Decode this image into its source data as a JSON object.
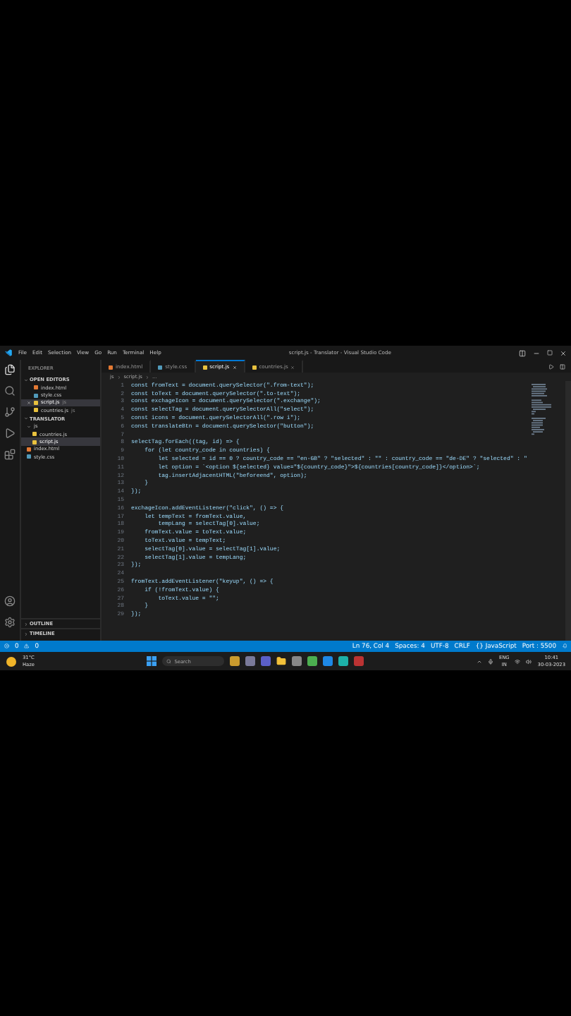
{
  "window": {
    "title": "script.js - Translator - Visual Studio Code"
  },
  "menu": [
    "File",
    "Edit",
    "Selection",
    "View",
    "Go",
    "Run",
    "Terminal",
    "Help"
  ],
  "sidebar": {
    "title": "EXPLORER",
    "sections": [
      {
        "label": "OPEN EDITORS",
        "expanded": true,
        "items": [
          {
            "name": "index.html",
            "kind": "html",
            "selected": false,
            "closable": false
          },
          {
            "name": "style.css",
            "kind": "css",
            "selected": false,
            "closable": false
          },
          {
            "name": "script.js",
            "kind": "js",
            "hint": "js",
            "selected": true,
            "closable": true
          },
          {
            "name": "countries.js",
            "kind": "js",
            "hint": "js",
            "selected": false,
            "closable": false
          }
        ]
      },
      {
        "label": "TRANSLATOR",
        "expanded": true,
        "items": [
          {
            "name": "js",
            "kind": "folder",
            "expanded": true,
            "selected": false,
            "children": [
              {
                "name": "countries.js",
                "kind": "js",
                "selected": false
              },
              {
                "name": "script.js",
                "kind": "js",
                "selected": true
              }
            ]
          },
          {
            "name": "index.html",
            "kind": "html",
            "selected": false
          },
          {
            "name": "style.css",
            "kind": "css",
            "selected": false
          }
        ]
      },
      {
        "label": "OUTLINE",
        "expanded": false
      },
      {
        "label": "TIMELINE",
        "expanded": false
      }
    ]
  },
  "tabs": [
    {
      "label": "index.html",
      "kind": "html",
      "selected": false,
      "closable": false
    },
    {
      "label": "style.css",
      "kind": "css",
      "selected": false,
      "closable": false
    },
    {
      "label": "script.js",
      "kind": "js",
      "selected": true,
      "closable": true
    },
    {
      "label": "countries.js",
      "kind": "js",
      "selected": false,
      "closable": true
    }
  ],
  "breadcrumb": [
    "js",
    "script.js",
    "..."
  ],
  "code": [
    {
      "number": "1",
      "text": "const fromText = document.querySelector(\".from-text\");"
    },
    {
      "number": "2",
      "text": "const toText = document.querySelector(\".to-text\");"
    },
    {
      "number": "3",
      "text": "const exchageIcon = document.querySelector(\".exchange\");"
    },
    {
      "number": "4",
      "text": "const selectTag = document.querySelectorAll(\"select\");"
    },
    {
      "number": "5",
      "text": "const icons = document.querySelectorAll(\".row i\");"
    },
    {
      "number": "6",
      "text": "const translateBtn = document.querySelector(\"button\");"
    },
    {
      "number": "7"
    },
    {
      "number": "8",
      "text": "selectTag.forEach((tag, id) => {"
    },
    {
      "number": "9",
      "text": "    for (let country_code in countries) {"
    },
    {
      "number": "10",
      "text": "        let selected = id == 0 ? country_code == \"en-GB\" ? \"selected\" : \"\" : country_code == \"de-DE\" ? \"selected\" : \""
    },
    {
      "number": "11",
      "text": "        let option = `<option ${selected} value=\"${country_code}\">${countries[country_code]}</option>`;"
    },
    {
      "number": "12",
      "text": "        tag.insertAdjacentHTML(\"beforeend\", option);"
    },
    {
      "number": "13",
      "text": "    }"
    },
    {
      "number": "14",
      "text": "});"
    },
    {
      "number": "15"
    },
    {
      "number": "16",
      "text": "exchageIcon.addEventListener(\"click\", () => {"
    },
    {
      "number": "17",
      "text": "    let tempText = fromText.value,"
    },
    {
      "number": "18",
      "text": "        tempLang = selectTag[0].value;"
    },
    {
      "number": "19",
      "text": "    fromText.value = toText.value;"
    },
    {
      "number": "20",
      "text": "    toText.value = tempText;"
    },
    {
      "number": "21",
      "text": "    selectTag[0].value = selectTag[1].value;"
    },
    {
      "number": "22",
      "text": "    selectTag[1].value = tempLang;"
    },
    {
      "number": "23",
      "text": "});"
    },
    {
      "number": "24"
    },
    {
      "number": "25",
      "text": "fromText.addEventListener(\"keyup\", () => {"
    },
    {
      "number": "26",
      "text": "    if (!fromText.value) {"
    },
    {
      "number": "27",
      "text": "        toText.value = \"\";"
    },
    {
      "number": "28",
      "text": "    }"
    },
    {
      "number": "29",
      "text": "});"
    }
  ],
  "status_bar": {
    "errors": "0",
    "warnings": "0",
    "items": [
      "Ln 76, Col 4",
      "Spaces: 4",
      "UTF-8",
      "CRLF",
      "{} JavaScript",
      "Port : 5500"
    ]
  },
  "taskbar": {
    "temperature": "31°C",
    "weather": "Haze",
    "search_placeholder": "Search",
    "language": "ENG",
    "region": "IN",
    "time": "10:41",
    "date": "30-03-2023"
  }
}
